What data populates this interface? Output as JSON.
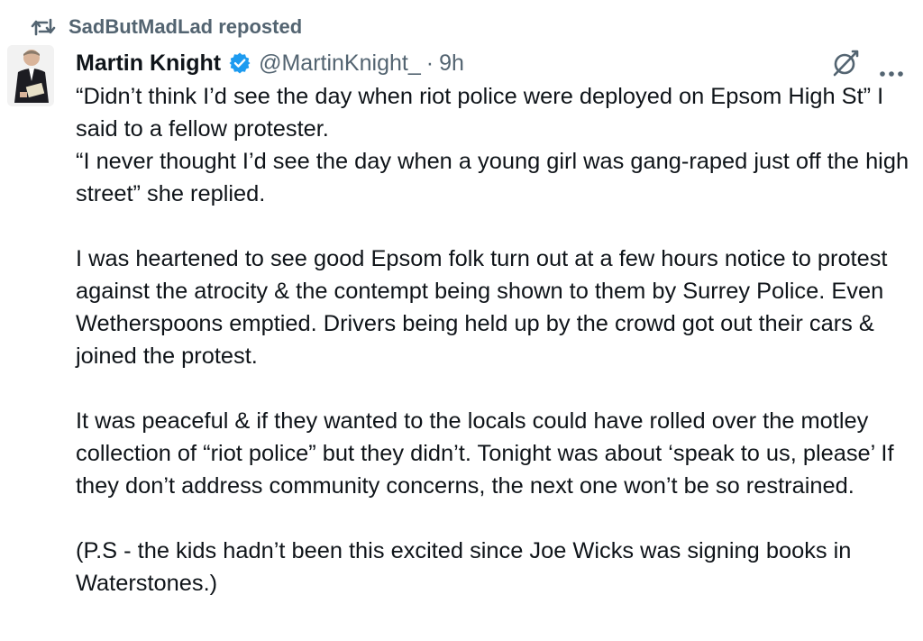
{
  "repost": {
    "icon": "repost-icon",
    "label": "SadButMadLad reposted"
  },
  "author": {
    "avatar_icon": "avatar",
    "name": "Martin Knight",
    "verified_icon": "verified-badge-icon",
    "handle": "@MartinKnight_",
    "separator": "·",
    "time": "9h"
  },
  "actions": {
    "grok_icon": "grok-icon",
    "more_icon": "more-options-icon"
  },
  "colors": {
    "secondary_text": "#536471",
    "verified_blue": "#1d9bf0",
    "text": "#0f1419"
  },
  "tweet": {
    "paragraphs": [
      "“Didn’t think I’d see the day when riot police were deployed on Epsom High St” I said to a fellow protester.",
      "“I never thought I’d see the day when a young girl was gang-raped just off the high street” she replied.",
      "I was heartened to see good Epsom folk turn out at a few hours notice to protest against the atrocity & the contempt being shown to them by Surrey Police. Even Wetherspoons emptied. Drivers being held up by the crowd got out their cars & joined the protest.",
      "It was peaceful & if they wanted to the locals could have rolled over the motley collection of “riot police” but they didn’t. Tonight was about ‘speak to us, please’ If they don’t  address community concerns, the next one won’t be so restrained.",
      "(P.S - the kids hadn’t been this excited since Joe Wicks was signing books in Waterstones.)"
    ]
  }
}
